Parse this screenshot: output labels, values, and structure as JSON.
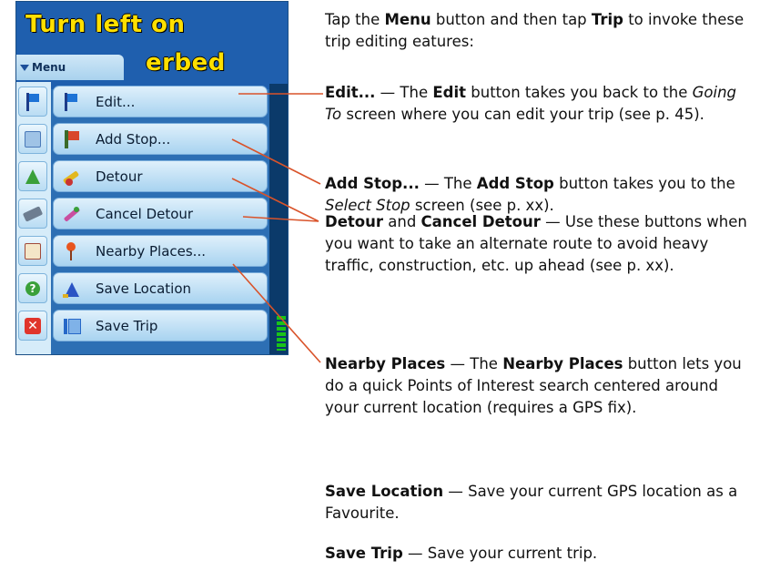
{
  "device": {
    "banner_line_1": "Turn left on",
    "banner_line_2": "erbed",
    "menu_tab_label": "Menu",
    "items": [
      {
        "label": "Edit...",
        "icon": "flag-icon",
        "left_icon": "flag-icon",
        "icon_color": "#1d73d6"
      },
      {
        "label": "Add Stop...",
        "icon": "add-stop-icon",
        "left_icon": "zoom-icon",
        "icon_color": "#d8472c"
      },
      {
        "label": "Detour",
        "icon": "detour-icon",
        "left_icon": "compass-icon",
        "icon_color": "#e2b81e"
      },
      {
        "label": "Cancel Detour",
        "icon": "cancel-detour-icon",
        "left_icon": "road-icon",
        "icon_color": "#c94fa0"
      },
      {
        "label": "Nearby Places...",
        "icon": "pin-icon",
        "left_icon": "clipboard-icon",
        "icon_color": "#e8551f"
      },
      {
        "label": "Save Location",
        "icon": "save-location-icon",
        "left_icon": "help-icon",
        "icon_color": "#2b54c4"
      },
      {
        "label": "Save Trip",
        "icon": "save-trip-icon",
        "left_icon": "close-icon",
        "icon_color": "#2668c8"
      }
    ]
  },
  "intro": {
    "prefix": "Tap the ",
    "menu": "Menu",
    "middle": " button and then tap ",
    "trip": "Trip",
    "suffix": " to invoke these trip editing eatures:"
  },
  "entries": {
    "edit": {
      "term": "Edit...",
      "sep": " — The ",
      "btn": "Edit",
      "t1": " button takes you back to the ",
      "screen": "Going To",
      "t2": " screen where you can edit your trip (see p. 45)."
    },
    "add_stop": {
      "term": "Add Stop...",
      "sep": " — The ",
      "btn": "Add Stop",
      "t1": " button takes you to the ",
      "screen": "Select Stop",
      "t2": " screen (see p. xx)."
    },
    "detour": {
      "term1": "Detour",
      "and": " and ",
      "term2": "Cancel Detour",
      "t1": " — Use these buttons when you want to take an alternate route to avoid heavy traffic, construction, etc. up ahead (see p. xx)."
    },
    "nearby": {
      "term": "Nearby Places",
      "sep": " — The ",
      "btn": "Nearby Places",
      "t1": " button lets you do a quick Points of Interest search centered around your current location (requires a GPS fix)."
    },
    "save_location": {
      "term": "Save Location",
      "t1": " — Save your current GPS location as a Favourite."
    },
    "save_trip": {
      "term": "Save Trip",
      "t1": " — Save your current trip."
    }
  },
  "colors": {
    "callout_line": "#d9532a",
    "banner_text": "#ffe000",
    "device_bg": "#2d6fb4"
  }
}
